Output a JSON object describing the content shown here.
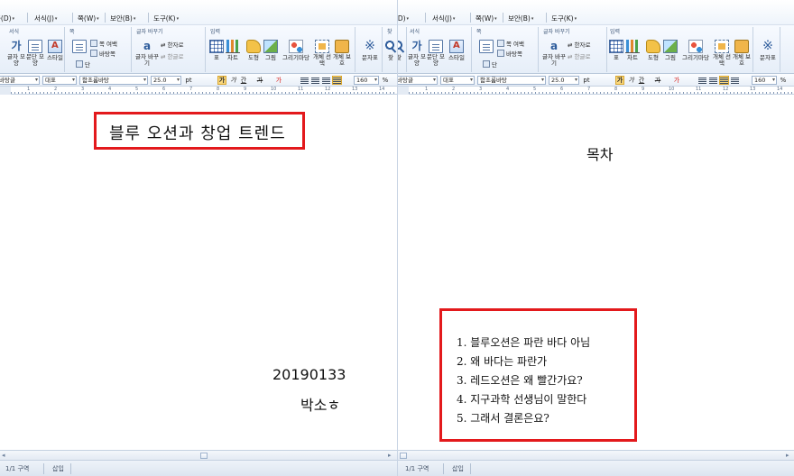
{
  "menu": {
    "left": [
      {
        "label": "쪽(D)"
      },
      {
        "label": "서식(J)"
      },
      {
        "label": "쪽(W)"
      },
      {
        "label": "보안(B)"
      },
      {
        "label": "도구(K)"
      }
    ],
    "right": [
      {
        "label": "쪽(D)"
      },
      {
        "label": "서식(J)"
      },
      {
        "label": "쪽(W)"
      },
      {
        "label": "보안(B)"
      },
      {
        "label": "도구(K)"
      }
    ]
  },
  "ribbon": {
    "groups": {
      "format": "서식",
      "page": "쪽",
      "wrap": "글자 바꾸기",
      "input": "입력",
      "find": "찾"
    },
    "tools": {
      "char_shape": "글자 모양",
      "para_shape": "문단 모양",
      "style": "스타일",
      "margin": "쪽 여백",
      "background": "바탕쪽",
      "columns": "단",
      "char_wrap": "글자 바꾸기",
      "hanja": "한자로",
      "hangul": "한글로",
      "table": "표",
      "chart": "차트",
      "shape": "도형",
      "picture": "그림",
      "drawing": "그리기마당",
      "object_select": "개체 선택",
      "object_protect": "개체 보호",
      "symbol": "문자표",
      "find": "찾"
    }
  },
  "format_bar": {
    "style_combo": "바탕글",
    "font_lang": "대표",
    "font_name": "함초롬바탕",
    "font_size": "25.0",
    "size_unit": "pt",
    "bold": "가",
    "italic": "가",
    "underline": "간",
    "strike": "가",
    "color": "가",
    "line_spacing": "160",
    "spacing_unit": "%"
  },
  "ruler": {
    "left_numbers": [
      "1",
      "2",
      "3",
      "4",
      "5",
      "6",
      "7",
      "8",
      "9",
      "10",
      "11",
      "12",
      "13",
      "14"
    ],
    "right_numbers": [
      "1",
      "2",
      "3",
      "4",
      "5",
      "6",
      "7",
      "8",
      "9",
      "10",
      "11",
      "12",
      "13",
      "14"
    ]
  },
  "doc_left": {
    "title": "블루 오션과 창업 트렌드",
    "student_id": "20190133",
    "student_name": "박소ㅎ"
  },
  "doc_right": {
    "toc_title": "목차",
    "toc_items": [
      "1. 블루오션은 파란 바다 아님",
      "2. 왜 바다는 파란가",
      "3. 레드오션은 왜 빨간가요?",
      "4. 지구과학 선생님이 말한다",
      "5. 그래서 결론은요?"
    ]
  },
  "status": {
    "left": {
      "section": "1/1 구역",
      "mode": "삽입"
    },
    "right": {
      "section": "1/1 구역",
      "mode": "삽입"
    }
  },
  "colors": {
    "highlight_border": "#e3191c",
    "ribbon_bg": "#e6eef8",
    "accent_yellow": "#fbd97e"
  }
}
